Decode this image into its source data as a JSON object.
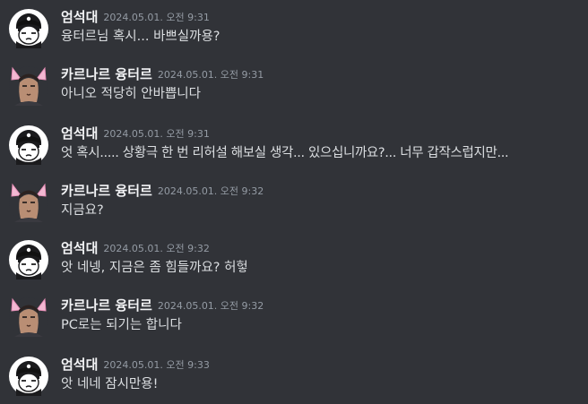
{
  "colors": {
    "background": "#313338",
    "author_text": "#f2f3f5",
    "message_text": "#dbdee1",
    "timestamp_text": "#949ba4"
  },
  "users": {
    "eom": {
      "name": "엄석대",
      "avatar_icon": "cartoon-boy-cap-avatar-icon"
    },
    "kar": {
      "name": "카르나르 융터르",
      "avatar_icon": "man-with-cat-ears-avatar-icon"
    }
  },
  "messages": [
    {
      "author": "엄석대",
      "timestamp": "2024.05.01. 오전 9:31",
      "text": "융터르님 혹시... 바쁘실까용?"
    },
    {
      "author": "카르나르 융터르",
      "timestamp": "2024.05.01. 오전 9:31",
      "text": "아니오 적당히 안바쁩니다"
    },
    {
      "author": "엄석대",
      "timestamp": "2024.05.01. 오전 9:31",
      "text": "엇 혹시..... 상황극 한 번 리허설 해보실 생각... 있으십니까요?... 너무 갑작스럽지만..."
    },
    {
      "author": "카르나르 융터르",
      "timestamp": "2024.05.01. 오전 9:32",
      "text": "지금요?"
    },
    {
      "author": "엄석대",
      "timestamp": "2024.05.01. 오전 9:32",
      "text": "앗 네넹, 지금은 좀 힘들까요? 허헣"
    },
    {
      "author": "카르나르 융터르",
      "timestamp": "2024.05.01. 오전 9:32",
      "text": "PC로는 되기는 합니다"
    },
    {
      "author": "엄석대",
      "timestamp": "2024.05.01. 오전 9:33",
      "text": "앗 네네 잠시만용!"
    }
  ]
}
